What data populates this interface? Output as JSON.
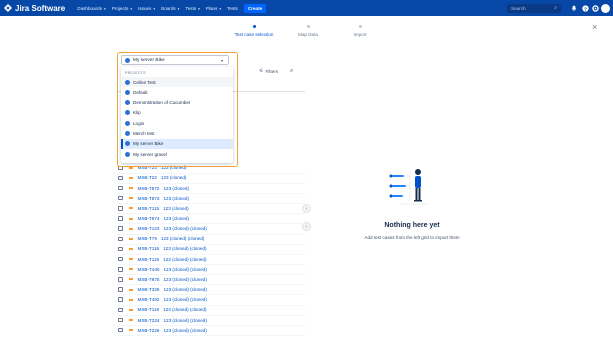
{
  "app": {
    "name": "Jira Software",
    "nav": [
      {
        "label": "Dashboards"
      },
      {
        "label": "Projects"
      },
      {
        "label": "Issues"
      },
      {
        "label": "Boards"
      },
      {
        "label": "Tests"
      },
      {
        "label": "Plans"
      },
      {
        "label": "Tests"
      }
    ],
    "create_label": "Create",
    "search_placeholder": "Search",
    "brand_color": "#0747a6"
  },
  "stepper": {
    "steps": [
      {
        "label": "Test case selection",
        "active": true
      },
      {
        "label": "Map Data",
        "active": false
      },
      {
        "label": "Import",
        "active": false
      }
    ]
  },
  "project_select": {
    "value": "My server Bike",
    "group_label": "PROJECTS",
    "options": [
      {
        "label": "Celine Test"
      },
      {
        "label": "Default"
      },
      {
        "label": "Demonstration of Cucumber"
      },
      {
        "label": "Klip"
      },
      {
        "label": "Login"
      },
      {
        "label": "Merch test"
      },
      {
        "label": "My server Bike"
      },
      {
        "label": "My server gravel"
      }
    ]
  },
  "toolbar": {
    "filters_label": "Filters"
  },
  "tests": [
    {
      "key": "MSB-T23",
      "name": "123 (cloned)"
    },
    {
      "key": "MSB-T22",
      "name": "123 (cloned)"
    },
    {
      "key": "MSB-T872",
      "name": "123 (cloned)"
    },
    {
      "key": "MSB-T873",
      "name": "123 (cloned)"
    },
    {
      "key": "MSB-T115",
      "name": "123 (cloned)"
    },
    {
      "key": "MSB-T874",
      "name": "123 (cloned)"
    },
    {
      "key": "MSB-T123",
      "name": "123 (cloned) (cloned)"
    },
    {
      "key": "MSB-T79",
      "name": "123 (cloned) (cloned)"
    },
    {
      "key": "MSB-T116",
      "name": "123 (cloned) (cloned)"
    },
    {
      "key": "MSB-T119",
      "name": "123 (cloned) (cloned)"
    },
    {
      "key": "MSB-T440",
      "name": "123 (cloned) (cloned)"
    },
    {
      "key": "MSB-T875",
      "name": "123 (cloned) (cloned)"
    },
    {
      "key": "MSB-T325",
      "name": "123 (cloned) (cloned)"
    },
    {
      "key": "MSB-T492",
      "name": "123 (cloned) (cloned)"
    },
    {
      "key": "MSB-T118",
      "name": "123 (cloned) (cloned)"
    },
    {
      "key": "MSB-T224",
      "name": "123 (cloned) (cloned)"
    },
    {
      "key": "MSB-T226",
      "name": "123 (cloned) (cloned)"
    }
  ],
  "empty_state": {
    "title": "Nothing here yet",
    "subtitle": "Add test cases from the left grid to import them"
  }
}
